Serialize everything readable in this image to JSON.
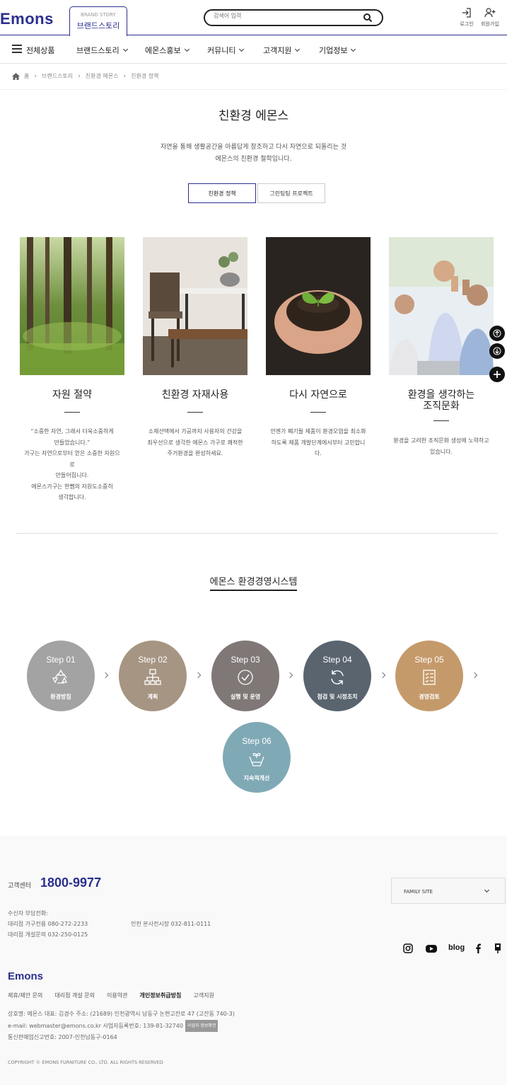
{
  "header": {
    "logo": "Emons",
    "brand_tab_en": "BRAND STORY",
    "brand_tab_kr": "브랜드스토리",
    "search_placeholder": "검색어 입력",
    "login": "로그인",
    "join": "회원가입"
  },
  "gnb": {
    "all": "전체상품",
    "menus": [
      "브랜드스토리",
      "에몬스홍보",
      "커뮤니티",
      "고객지원",
      "기업정보"
    ]
  },
  "breadcrumb": [
    "홈",
    "브랜드스토리",
    "친환경 에몬스",
    "친환경 정책"
  ],
  "page": {
    "title": "친환경 에몬스",
    "desc_line1": "자연을 통해 생활공간을 아름답게 창조하고 다시 자연으로 되돌리는 것",
    "desc_line2": "에몬스의 친환경 철학입니다.",
    "tab1": "친환경 정책",
    "tab2": "그린팅팅 프로젝트"
  },
  "cards": [
    {
      "title": "자원 절약",
      "lines": [
        "“소중한 자연, 그래서 더욱소중하게",
        "만들었습니다.”",
        "가구는 자연으로부터 얻은 소중한 자원으로",
        "만들어집니다.",
        "에몬스가구는 한뼘의 자원도소중히",
        "생각합니다."
      ]
    },
    {
      "title": "친환경 자재사용",
      "lines": [
        "소재선택에서 가공까지 사용자의 건강을",
        "최우선으로 생각한 에몬스 가구로 쾌적한",
        "주거환경을 완성하세요."
      ]
    },
    {
      "title": "다시 자연으로",
      "lines": [
        "언젠가 폐기될 제품이 환경오염을 최소화",
        "하도록 제품 개발단계에서부터 고민합니다."
      ]
    },
    {
      "title": "환경을 생각하는",
      "title2": "조직문화",
      "lines": [
        "환경을 고려한 조직문화 생성에 노력하고",
        "있습니다."
      ]
    }
  ],
  "system": {
    "title": "에몬스 환경경영시스템",
    "steps": [
      {
        "n": "Step 01",
        "label": "환경방침",
        "color": "#a3a3a3",
        "icon": "recycle-icon"
      },
      {
        "n": "Step 02",
        "label": "계획",
        "color": "#a69583",
        "icon": "org-chart-icon"
      },
      {
        "n": "Step 03",
        "label": "실행 및 운영",
        "color": "#7f7877",
        "icon": "check-circle-icon"
      },
      {
        "n": "Step 04",
        "label": "점검 및 시정조치",
        "color": "#59646f",
        "icon": "refresh-icon"
      },
      {
        "n": "Step 05",
        "label": "경영검토",
        "color": "#c59a6b",
        "icon": "checklist-icon"
      },
      {
        "n": "Step 06",
        "label": "지속적개선",
        "color": "#80a9b6",
        "icon": "hands-plant-icon"
      }
    ]
  },
  "footer": {
    "cs_label": "고객센터",
    "phone": "1800-9977",
    "family_site": "FAMILY SITE",
    "info1": "수신자 부담전화:",
    "info2": "대리점 가구전용    080-272-2233",
    "info3": "대리점 개설문의    032-250-0125",
    "info4": "인천 본사전시장    032-811-0111",
    "blog": "blog",
    "logo": "Emons",
    "links": [
      "제휴/제안 문의",
      "대리점 개설 문의",
      "이용약관",
      "개인정보취급방침",
      "고객지원"
    ],
    "addr1": "상호명: 에몬스     대표: 김경수     주소: (21689) 인천광역시 남동구 논현고잔로 47 (고잔동 740-3)",
    "addr2": "e-mail: webmaster@emons.co.kr     사업자등록번호: 139-81-32740",
    "badge": "사업자 정보확인",
    "addr3": "통신판매업신고번호: 2007-인천남동구-0164",
    "copyright": "COPYRIGHT © EMONS FURNITURE CO., LTD. ALL RIGHTS RESERVED"
  }
}
